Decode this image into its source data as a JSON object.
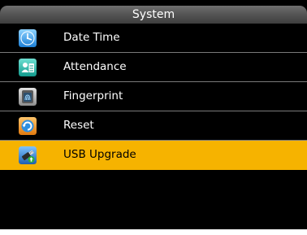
{
  "header": {
    "title": "System"
  },
  "menu": {
    "items": [
      {
        "label": "Date Time",
        "icon": "clock-icon"
      },
      {
        "label": "Attendance",
        "icon": "attendance-icon"
      },
      {
        "label": "Fingerprint",
        "icon": "fingerprint-icon"
      },
      {
        "label": "Reset",
        "icon": "reset-icon"
      },
      {
        "label": "USB Upgrade",
        "icon": "usb-icon",
        "selected": true
      }
    ]
  },
  "colors": {
    "screen_background": "#000000",
    "selection_highlight": "#f6b300",
    "title_bar": "#565656",
    "divider": "#7a7a7a"
  }
}
